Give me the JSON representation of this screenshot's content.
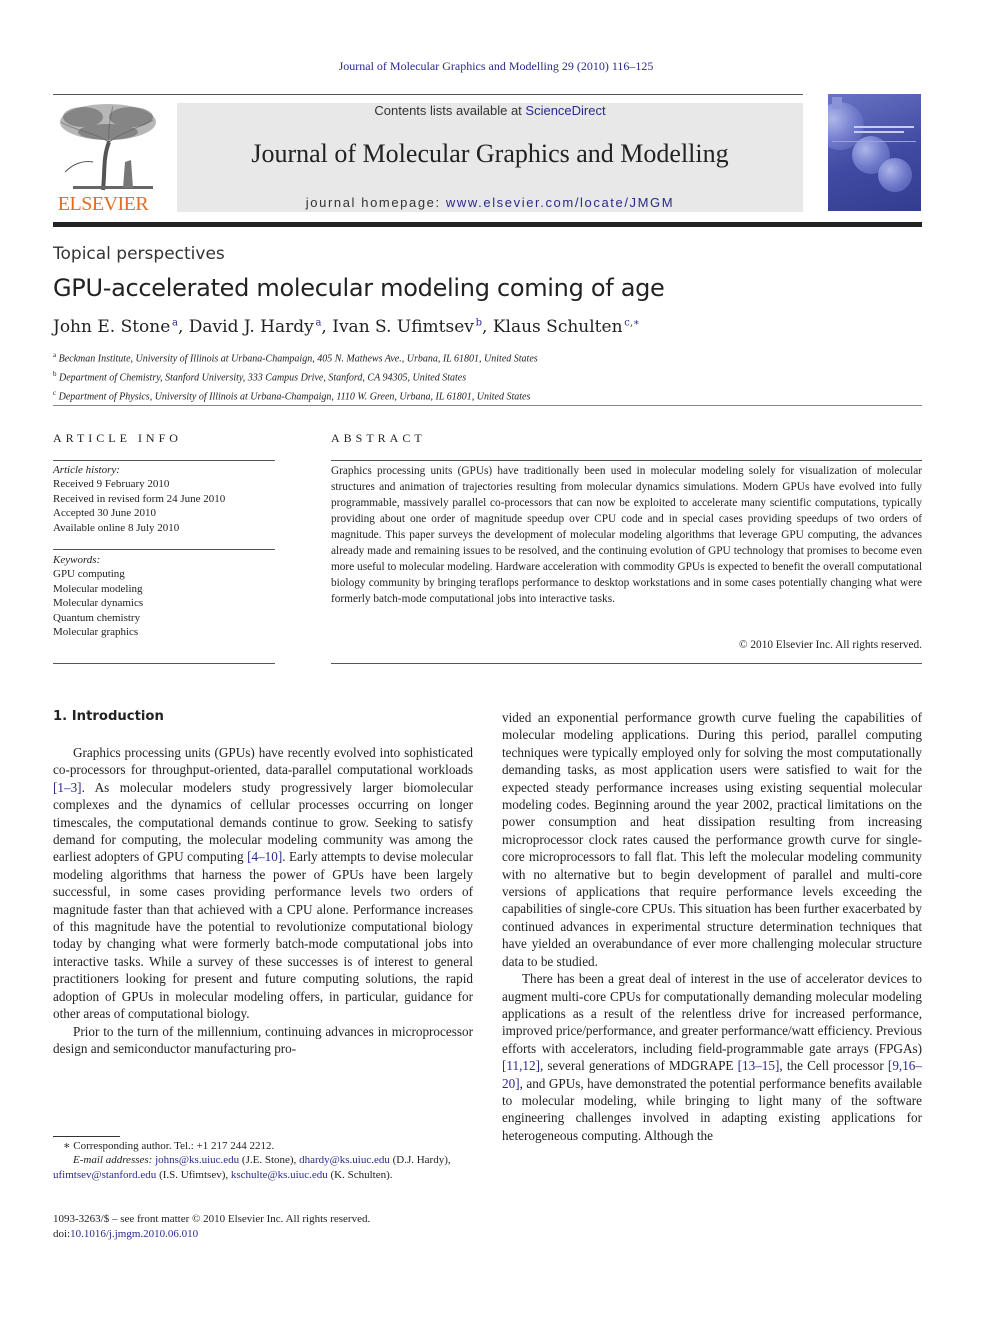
{
  "running_head": "Journal of Molecular Graphics and Modelling 29 (2010) 116–125",
  "masthead": {
    "publisher_logo_text": "ELSEVIER",
    "contents_prefix": "Contents lists available at ",
    "contents_link": "ScienceDirect",
    "journal_name": "Journal of Molecular Graphics and Modelling",
    "homepage_prefix": "journal homepage: ",
    "homepage_link": "www.elsevier.com/locate/JMGM",
    "cover_alt": "Journal cover"
  },
  "article": {
    "section_type": "Topical perspectives",
    "title": "GPU-accelerated molecular modeling coming of age",
    "authors": [
      {
        "name": "John E. Stone",
        "aff": "a",
        "sep": ", "
      },
      {
        "name": "David J. Hardy",
        "aff": "a",
        "sep": ", "
      },
      {
        "name": "Ivan S. Ufimtsev",
        "aff": "b",
        "sep": ", "
      },
      {
        "name": "Klaus Schulten",
        "aff": "c,∗",
        "sep": ""
      }
    ],
    "affiliations": [
      {
        "key": "a",
        "text": "Beckman Institute, University of Illinois at Urbana-Champaign, 405 N. Mathews Ave., Urbana, IL 61801, United States"
      },
      {
        "key": "b",
        "text": "Department of Chemistry, Stanford University, 333 Campus Drive, Stanford, CA 94305, United States"
      },
      {
        "key": "c",
        "text": "Department of Physics, University of Illinois at Urbana-Champaign, 1110 W. Green, Urbana, IL 61801, United States"
      }
    ]
  },
  "article_info": {
    "heading": "ARTICLE INFO",
    "history_label": "Article history:",
    "history": [
      "Received 9 February 2010",
      "Received in revised form 24 June 2010",
      "Accepted 30 June 2010",
      "Available online 8 July 2010"
    ],
    "keywords_label": "Keywords:",
    "keywords": [
      "GPU computing",
      "Molecular modeling",
      "Molecular dynamics",
      "Quantum chemistry",
      "Molecular graphics"
    ]
  },
  "abstract": {
    "heading": "ABSTRACT",
    "text": "Graphics processing units (GPUs) have traditionally been used in molecular modeling solely for visualization of molecular structures and animation of trajectories resulting from molecular dynamics simulations. Modern GPUs have evolved into fully programmable, massively parallel co-processors that can now be exploited to accelerate many scientific computations, typically providing about one order of magnitude speedup over CPU code and in special cases providing speedups of two orders of magnitude. This paper surveys the development of molecular modeling algorithms that leverage GPU computing, the advances already made and remaining issues to be resolved, and the continuing evolution of GPU technology that promises to become even more useful to molecular modeling. Hardware acceleration with commodity GPUs is expected to benefit the overall computational biology community by bringing teraflops performance to desktop workstations and in some cases potentially changing what were formerly batch-mode computational jobs into interactive tasks.",
    "copyright": "© 2010 Elsevier Inc. All rights reserved."
  },
  "body": {
    "section_heading": "1.  Introduction",
    "left_p1": [
      {
        "t": "Graphics processing units (GPUs) have recently evolved into sophisticated co-processors for throughput-oriented, data-parallel computational workloads "
      },
      {
        "ref": "[1–3]"
      },
      {
        "t": ". As molecular modelers study progressively larger biomolecular complexes and the dynamics of cellular processes occurring on longer timescales, the computational demands continue to grow. Seeking to satisfy demand for computing, the molecular modeling community was among the earliest adopters of GPU computing "
      },
      {
        "ref": "[4–10]"
      },
      {
        "t": ". Early attempts to devise molecular modeling algorithms that harness the power of GPUs have been largely successful, in some cases providing performance levels two orders of magnitude faster than that achieved with a CPU alone. Performance increases of this magnitude have the potential to revolutionize computational biology today by changing what were formerly batch-mode computational jobs into interactive tasks. While a survey of these successes is of interest to general practitioners looking for present and future computing solutions, the rapid adoption of GPUs in molecular modeling offers, in particular, guidance for other areas of computational biology."
      }
    ],
    "left_p2": "Prior to the turn of the millennium, continuing advances in microprocessor design and semiconductor manufacturing pro-",
    "right_p1": "vided an exponential performance growth curve fueling the capabilities of molecular modeling applications. During this period, parallel computing techniques were typically employed only for solving the most computationally demanding tasks, as most application users were satisfied to wait for the expected steady performance increases using existing sequential molecular modeling codes. Beginning around the year 2002, practical limitations on the power consumption and heat dissipation resulting from increasing microprocessor clock rates caused the performance growth curve for single-core microprocessors to fall flat. This left the molecular modeling community with no alternative but to begin development of parallel and multi-core versions of applications that require performance levels exceeding the capabilities of single-core CPUs. This situation has been further exacerbated by continued advances in experimental structure determination techniques that have yielded an overabundance of ever more challenging molecular structure data to be studied.",
    "right_p2": [
      {
        "t": "There has been a great deal of interest in the use of accelerator devices to augment multi-core CPUs for computationally demanding molecular modeling applications as a result of the relentless drive for increased performance, improved price/performance, and greater performance/watt efficiency. Previous efforts with accelerators, including field-programmable gate arrays (FPGAs) "
      },
      {
        "ref": "[11,12]"
      },
      {
        "t": ", several generations of MDGRAPE "
      },
      {
        "ref": "[13–15]"
      },
      {
        "t": ", the Cell processor "
      },
      {
        "ref": "[9,16–20]"
      },
      {
        "t": ", and GPUs, have demonstrated the potential performance benefits available to molecular modeling, while bringing to light many of the software engineering challenges involved in adapting existing applications for heterogeneous computing. Although the"
      }
    ]
  },
  "footnotes": {
    "corresponding": "∗  Corresponding author. Tel.: +1 217 244 2212.",
    "email_label": "E-mail addresses: ",
    "emails": [
      {
        "email": "johns@ks.uiuc.edu",
        "who": " (J.E. Stone), "
      },
      {
        "email": "dhardy@ks.uiuc.edu",
        "who": " (D.J. Hardy), "
      },
      {
        "email": "ufimtsev@stanford.edu",
        "who": " (I.S. Ufimtsev), "
      },
      {
        "email": "kschulte@ks.uiuc.edu",
        "who": " (K. Schulten)."
      }
    ],
    "front_matter": "1093-3263/$ – see front matter © 2010 Elsevier Inc. All rights reserved.",
    "doi_prefix": "doi:",
    "doi": "10.1016/j.jmgm.2010.06.010"
  },
  "colors": {
    "link": "#2a2a8c",
    "elsevier_orange": "#e46e1e",
    "masthead_bg": "#e8e8e8",
    "cover_blue": "#3f4aa2"
  }
}
